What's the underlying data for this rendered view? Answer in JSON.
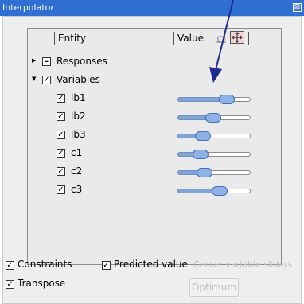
{
  "window": {
    "title": "Interpolator",
    "close_glyph": "⊠"
  },
  "tree": {
    "columns": {
      "entity": "Entity",
      "value": "Value"
    },
    "header_icons": [
      "range-icon",
      "move-icon"
    ],
    "groups": [
      {
        "label": "Responses",
        "expanded": false,
        "checked": false,
        "mark": "–"
      },
      {
        "label": "Variables",
        "expanded": true,
        "checked": true,
        "mark": "✓"
      }
    ],
    "variables": [
      {
        "name": "lb1",
        "checked": true,
        "level": 0.72
      },
      {
        "name": "lb2",
        "checked": true,
        "level": 0.48
      },
      {
        "name": "lb3",
        "checked": true,
        "level": 0.3
      },
      {
        "name": "c1",
        "checked": true,
        "level": 0.27
      },
      {
        "name": "c2",
        "checked": true,
        "level": 0.34
      },
      {
        "name": "c3",
        "checked": true,
        "level": 0.6
      }
    ]
  },
  "options": {
    "constraints": "Constraints",
    "predicted_value": "Predicted value",
    "center_sliders": "Center variable sliders",
    "transpose": "Transpose",
    "optimum": "Optimum"
  },
  "check_mark": "✓",
  "colors": {
    "title_bar": "#2f6fd1",
    "arrow": "#1f2b8f",
    "slider_fill": "#7fa4d8"
  }
}
